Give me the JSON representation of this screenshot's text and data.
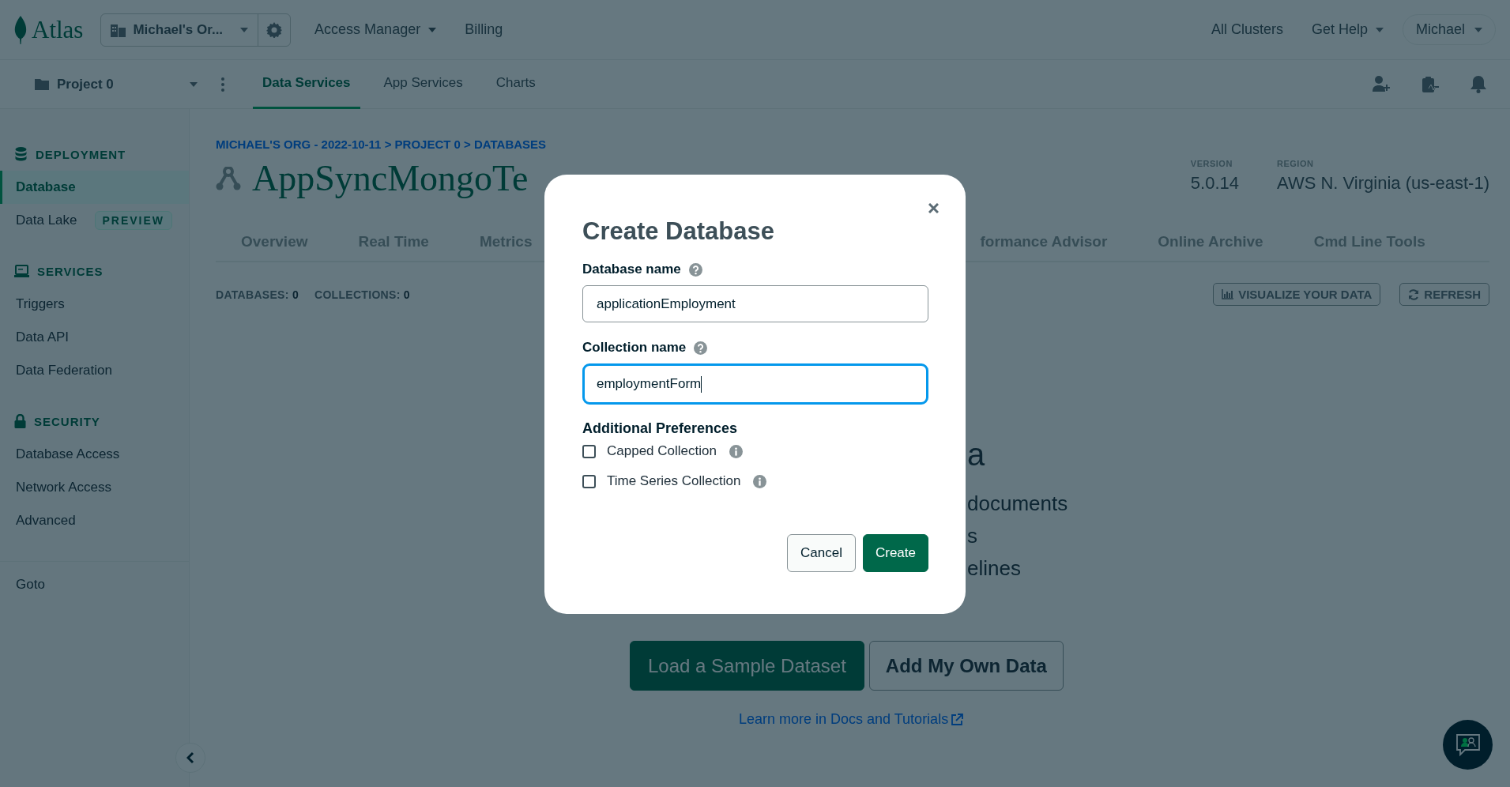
{
  "top_bar": {
    "logo": "Atlas",
    "org": "Michael's Or...",
    "menus": [
      {
        "label": "Access Manager",
        "dropdown": true
      },
      {
        "label": "Billing",
        "dropdown": false
      }
    ],
    "right_menus": [
      {
        "label": "All Clusters",
        "dropdown": false
      },
      {
        "label": "Get Help",
        "dropdown": true
      }
    ],
    "user": "Michael"
  },
  "project_bar": {
    "project": "Project 0",
    "tabs": [
      {
        "label": "Data Services",
        "selected": true
      },
      {
        "label": "App Services",
        "selected": false
      },
      {
        "label": "Charts",
        "selected": false
      }
    ]
  },
  "sidebar": {
    "sections": [
      {
        "title": "DEPLOYMENT",
        "items": [
          {
            "label": "Database",
            "selected": true
          },
          {
            "label": "Data Lake",
            "selected": false,
            "badge": "PREVIEW"
          }
        ]
      },
      {
        "title": "SERVICES",
        "items": [
          {
            "label": "Triggers",
            "selected": false
          },
          {
            "label": "Data API",
            "selected": false
          },
          {
            "label": "Data Federation",
            "selected": false
          }
        ]
      },
      {
        "title": "SECURITY",
        "items": [
          {
            "label": "Database Access",
            "selected": false
          },
          {
            "label": "Network Access",
            "selected": false
          },
          {
            "label": "Advanced",
            "selected": false
          }
        ]
      }
    ],
    "footer_item": "Goto"
  },
  "header": {
    "breadcrumb": "MICHAEL'S ORG - 2022-10-11 > PROJECT 0 > DATABASES",
    "title": "AppSyncMongoTe",
    "meta": [
      {
        "label": "VERSION",
        "value": "5.0.14"
      },
      {
        "label": "REGION",
        "value": "AWS N. Virginia (us-east-1)"
      }
    ]
  },
  "tabs_left": [
    "Overview",
    "Real Time",
    "Metrics"
  ],
  "tabs_right": [
    "formance Advisor",
    "Online Archive",
    "Cmd Line Tools"
  ],
  "counts": [
    {
      "label": "DATABASES:",
      "value": "0"
    },
    {
      "label": "COLLECTIONS:",
      "value": "0"
    }
  ],
  "actions": [
    "VISUALIZE YOUR DATA",
    "REFRESH"
  ],
  "empty_state": {
    "heading": "a",
    "lines": [
      "documents",
      "s",
      "elines"
    ],
    "buttons": [
      {
        "label": "Load a Sample Dataset",
        "primary": true
      },
      {
        "label": "Add My Own Data",
        "primary": false
      }
    ],
    "link": "Learn more in Docs and Tutorials"
  },
  "modal": {
    "title": "Create Database",
    "fields": [
      {
        "label": "Database name",
        "value": "applicationEmployment",
        "focused": false
      },
      {
        "label": "Collection name",
        "value": "employmentForm",
        "focused": true
      }
    ],
    "preferences_title": "Additional Preferences",
    "options": [
      {
        "label": "Capped Collection",
        "checked": false
      },
      {
        "label": "Time Series Collection",
        "checked": false
      }
    ],
    "cancel": "Cancel",
    "submit": "Create"
  }
}
